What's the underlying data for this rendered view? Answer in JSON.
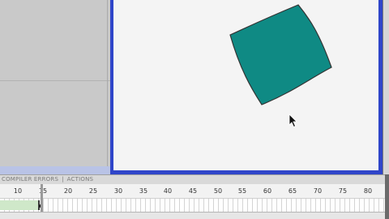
{
  "panel": {
    "tab_compiler_errors": "COMPILER ERRORS",
    "tab_separator": "|",
    "tab_actions": "ACTIONS"
  },
  "timeline": {
    "ruler_ticks": [
      "10",
      "15",
      "20",
      "25",
      "30",
      "35",
      "40",
      "45",
      "50",
      "55",
      "60",
      "65",
      "70",
      "75",
      "80"
    ],
    "current_frame": 15
  },
  "stage": {
    "shape_color": "#0f8a84",
    "shape_stroke": "#333333",
    "border_color": "#2f45c9"
  },
  "icons": {
    "cursor": "arrow-cursor-icon"
  }
}
